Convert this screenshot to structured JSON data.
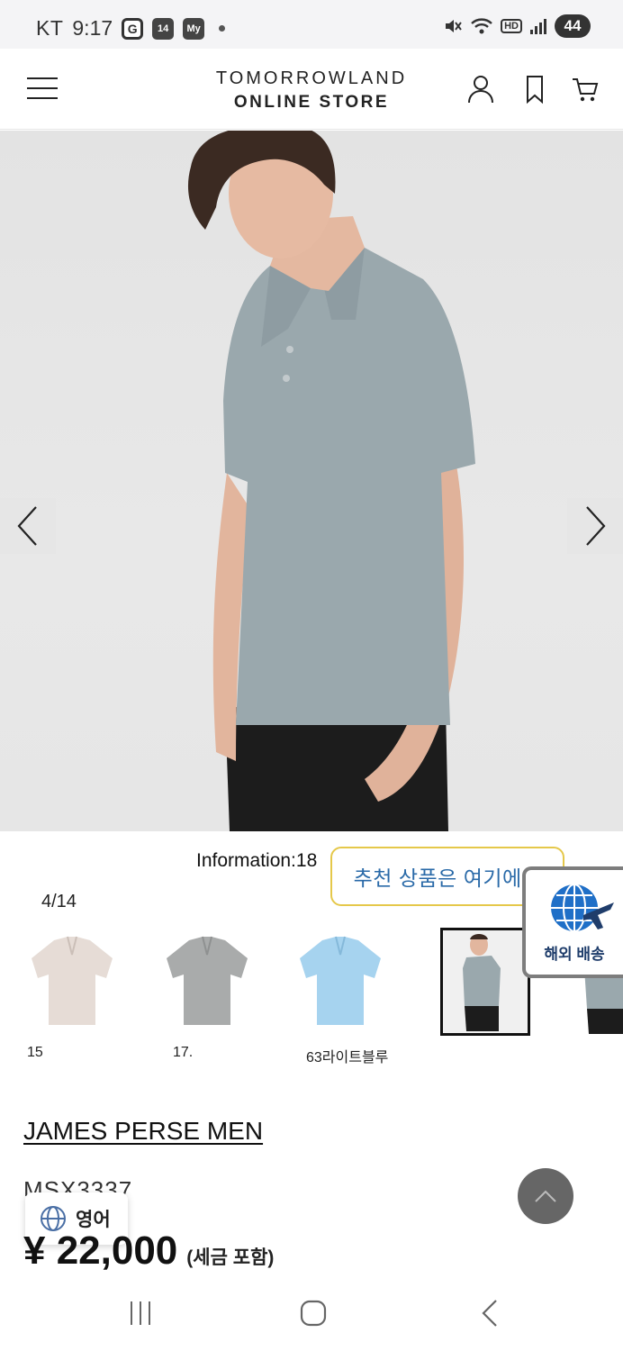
{
  "status_bar": {
    "carrier": "KT",
    "time": "9:17",
    "calendar_badge": "14",
    "app_badge": "My",
    "hd_label": "HD",
    "battery": "44"
  },
  "header": {
    "logo_line1": "TOMORROWLAND",
    "logo_line2": "ONLINE STORE"
  },
  "gallery": {
    "information": "Information:18",
    "counter": "4/14",
    "thumbnails": [
      {
        "label": "15",
        "color": "#e6dcd6"
      },
      {
        "label": "17.",
        "color": "#a9abab"
      },
      {
        "label": "63라이트블루",
        "color": "#a6d3ef"
      },
      {
        "label": "",
        "color": "#9aa8ad"
      }
    ]
  },
  "recommend_tooltip": "추천 상품은 여기에서",
  "overseas_label": "해외 배송",
  "product": {
    "brand": "JAMES PERSE MEN",
    "code": "MSX3337",
    "price": "¥ 22,000",
    "tax_note": "(세금 포함)"
  },
  "language_button": "영어",
  "colors": {
    "accent_blue": "#2a6aa8",
    "tooltip_border": "#e5c84a",
    "shirt": "#9aa8ad"
  }
}
